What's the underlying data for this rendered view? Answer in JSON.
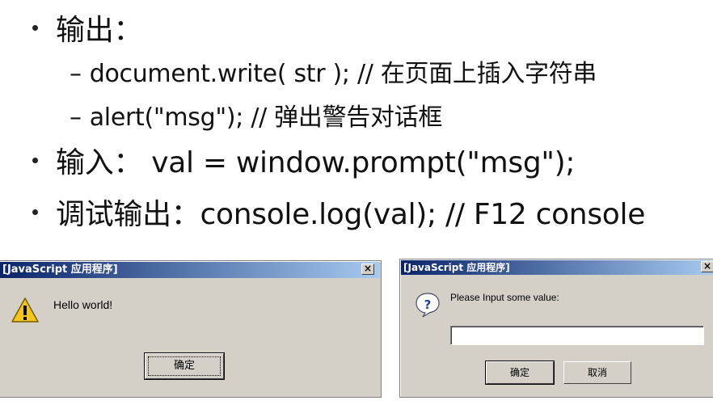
{
  "slide": {
    "bullet1": {
      "text": "输出："
    },
    "sub1": {
      "dash": "–",
      "text": "document.write( str ); // 在页面上插入字符串"
    },
    "sub2": {
      "dash": "–",
      "text": "alert(\"msg\"); // 弹出警告对话框"
    },
    "bullet2": {
      "text": "输入： val = window.prompt(\"msg\");"
    },
    "bullet3": {
      "text": "调试输出：console.log(val); // F12 console"
    }
  },
  "alert_dialog": {
    "title": "[JavaScript 应用程序]",
    "close_glyph": "×",
    "icon": "warning-icon",
    "message": "Hello world!",
    "ok_label": "确定"
  },
  "prompt_dialog": {
    "title": "[JavaScript 应用程序]",
    "close_glyph": "×",
    "icon": "question-icon",
    "message": "Please Input some value:",
    "input_value": "",
    "ok_label": "确定",
    "cancel_label": "取消"
  },
  "colors": {
    "titlebar_start": "#0a246a",
    "titlebar_end": "#a6caf0",
    "dialog_bg": "#d4d0c8"
  }
}
